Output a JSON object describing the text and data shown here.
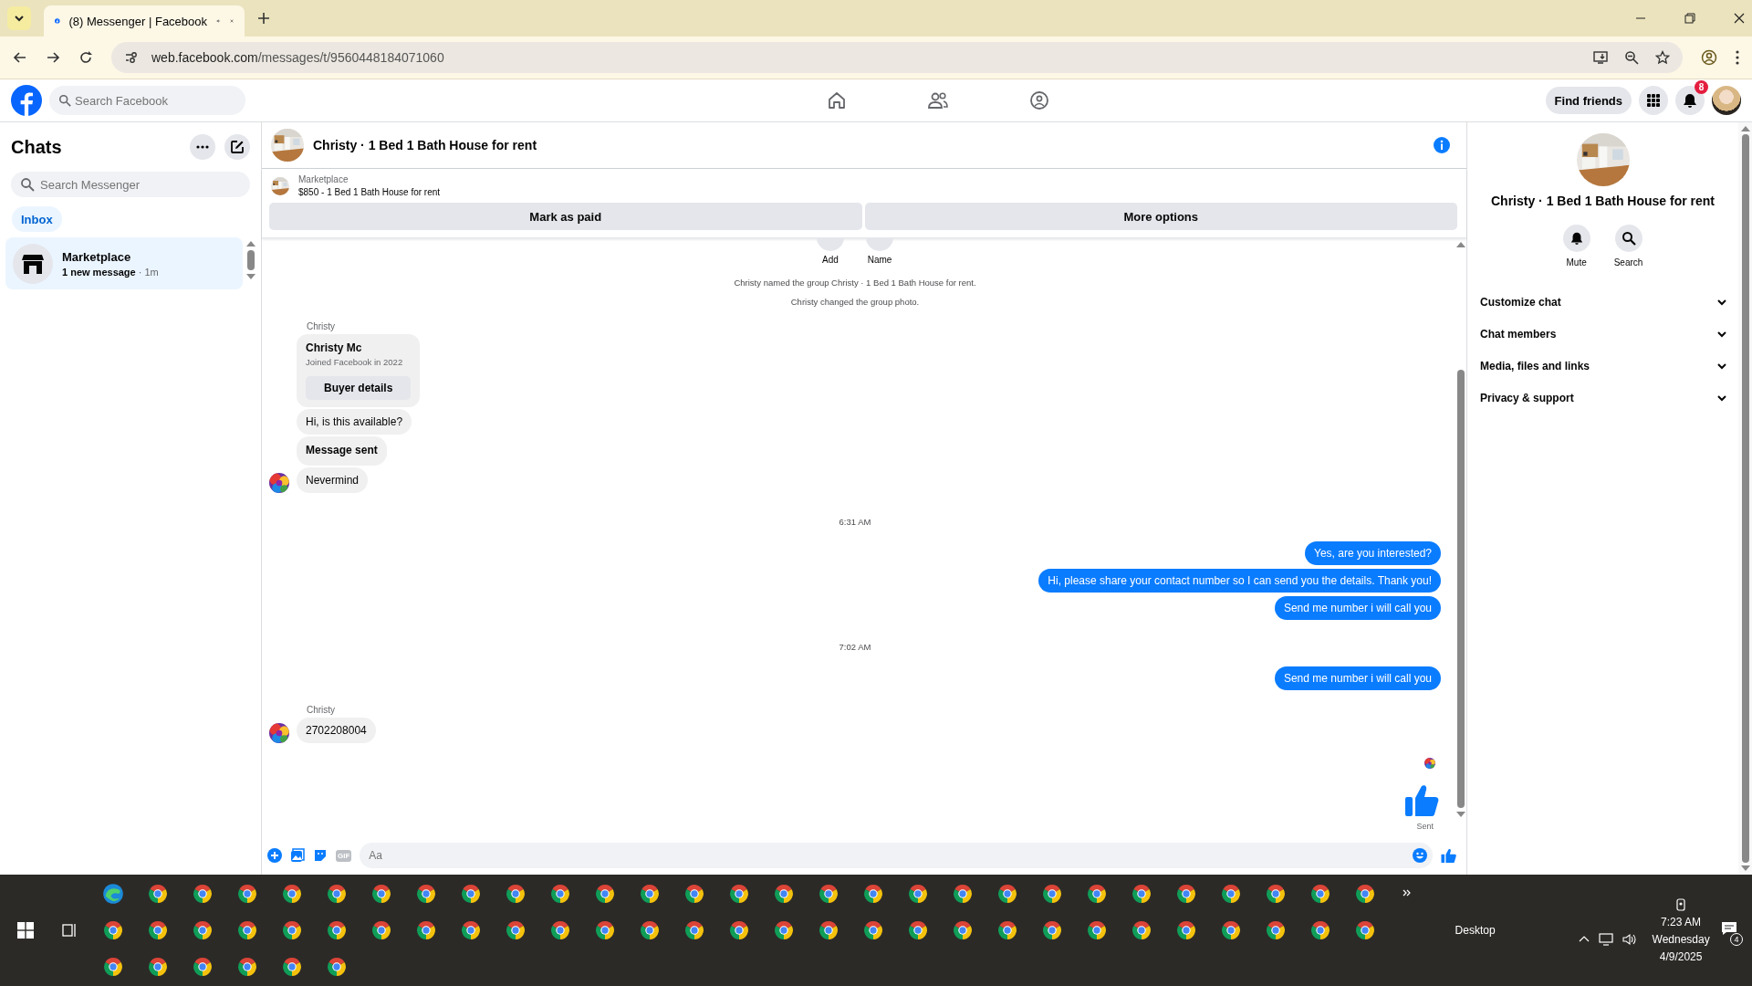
{
  "browser": {
    "tab": {
      "title": "(8) Messenger | Facebook"
    },
    "url_host": "web.facebook.com",
    "url_path": "/messages/t/9560448184071060"
  },
  "facebook_nav": {
    "search_placeholder": "Search Facebook",
    "find_friends": "Find friends",
    "notification_count": "8"
  },
  "sidebar": {
    "title": "Chats",
    "search_placeholder": "Search Messenger",
    "filters": [
      {
        "label": "Inbox",
        "selected": true
      }
    ],
    "chats": [
      {
        "name": "Marketplace",
        "preview": "1 new message",
        "time": "· 1m",
        "selected": true
      }
    ]
  },
  "conversation": {
    "title": "Christy · 1 Bed 1 Bath House for rent",
    "listing": {
      "source": "Marketplace",
      "title": "$850 - 1 Bed 1 Bath House for rent"
    },
    "actions": [
      "Mark as paid",
      "More options"
    ],
    "group_actions": [
      "Add",
      "Name"
    ],
    "messages": [
      {
        "kind": "system",
        "text": "Christy named the group Christy · 1 Bed 1 Bath House for rent."
      },
      {
        "kind": "system",
        "text": "Christy changed the group photo."
      },
      {
        "kind": "sender",
        "text": "Christy"
      },
      {
        "kind": "card",
        "name": "Christy Mc",
        "subtitle": "Joined Facebook in 2022",
        "button": "Buyer details"
      },
      {
        "kind": "incoming",
        "text": "Hi, is this available?",
        "avatar": false,
        "emphasis": false
      },
      {
        "kind": "incoming",
        "text": "Message sent",
        "avatar": false,
        "emphasis": true
      },
      {
        "kind": "incoming",
        "text": "Nevermind",
        "avatar": true,
        "emphasis": false
      },
      {
        "kind": "time",
        "text": "6:31 AM"
      },
      {
        "kind": "outgoing",
        "text": "Yes, are you interested?"
      },
      {
        "kind": "outgoing",
        "text": "Hi, please share your contact number so I can send you the details. Thank you!"
      },
      {
        "kind": "outgoing",
        "text": "Send me number i will call you"
      },
      {
        "kind": "time",
        "text": "7:02 AM"
      },
      {
        "kind": "outgoing",
        "text": "Send me number i will call you"
      },
      {
        "kind": "sender",
        "text": "Christy"
      },
      {
        "kind": "incoming",
        "text": "2702208004",
        "avatar": true,
        "emphasis": false
      },
      {
        "kind": "like",
        "status": "Sent"
      }
    ],
    "composer": {
      "placeholder": "Aa",
      "gif": "GIF"
    }
  },
  "details": {
    "title": "Christy · 1 Bed 1 Bath House for rent",
    "actions": [
      {
        "kind": "mute",
        "label": "Mute"
      },
      {
        "kind": "search",
        "label": "Search"
      }
    ],
    "sections": [
      {
        "label": "Customize chat",
        "expanded": false
      },
      {
        "label": "Chat members",
        "expanded": false
      },
      {
        "label": "Media, files and links",
        "expanded": false
      },
      {
        "label": "Privacy & support",
        "expanded": false
      }
    ]
  },
  "taskbar": {
    "desktop_label": "Desktop",
    "time": "7:23 AM",
    "day": "Wednesday",
    "date": "4/9/2025",
    "notification_count": "4"
  }
}
